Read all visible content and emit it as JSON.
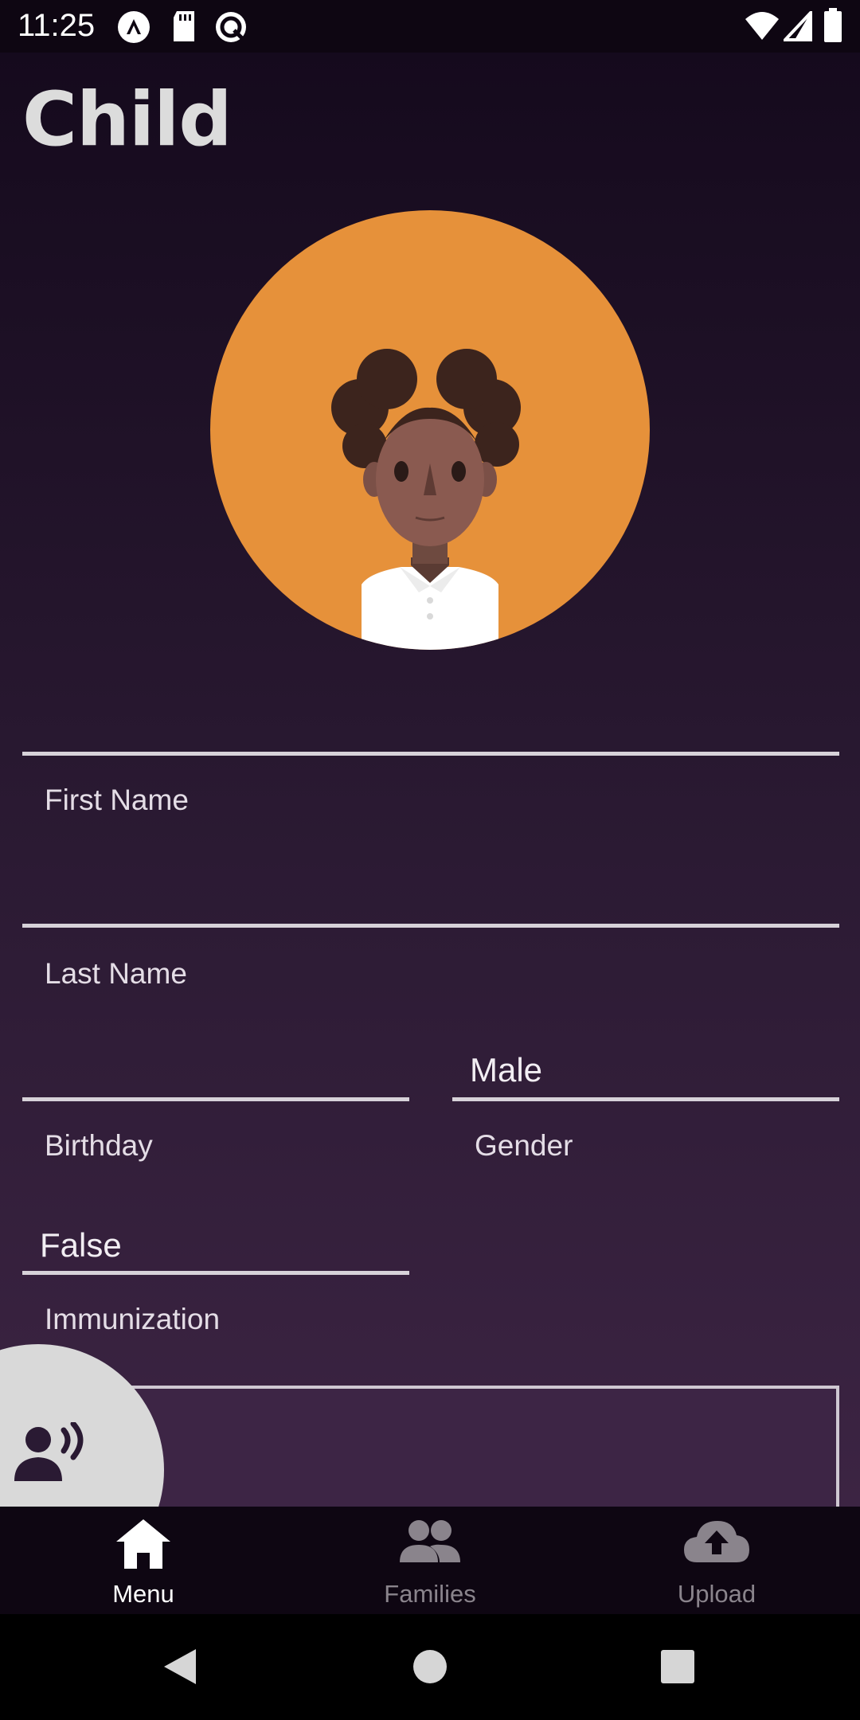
{
  "status_bar": {
    "time": "11:25",
    "icons_left": [
      "app-notification-icon",
      "sd-card-icon",
      "sync-icon"
    ],
    "icons_right": [
      "wifi-icon",
      "cell-signal-icon",
      "battery-icon"
    ]
  },
  "page": {
    "title": "Child"
  },
  "avatar": {
    "icon": "child-avatar-illustration",
    "background_color": "#e6913a"
  },
  "form": {
    "first_name": {
      "label": "First Name",
      "value": ""
    },
    "last_name": {
      "label": "Last Name",
      "value": ""
    },
    "birthday": {
      "label": "Birthday",
      "value": ""
    },
    "gender": {
      "label": "Gender",
      "value": "Male"
    },
    "immunization": {
      "label": "Immunization",
      "value": "False"
    },
    "notes": {
      "value": ""
    }
  },
  "voice_button": {
    "icon": "voice-speaker-icon"
  },
  "bottom_nav": {
    "items": [
      {
        "label": "Menu",
        "icon": "home-icon",
        "active": true
      },
      {
        "label": "Families",
        "icon": "people-icon",
        "active": false
      },
      {
        "label": "Upload",
        "icon": "cloud-upload-icon",
        "active": false
      }
    ],
    "active_color": "#ffffff",
    "inactive_color": "#8a848c"
  },
  "system_nav": {
    "icons": [
      "back-icon",
      "home-circle-icon",
      "recents-icon"
    ]
  }
}
